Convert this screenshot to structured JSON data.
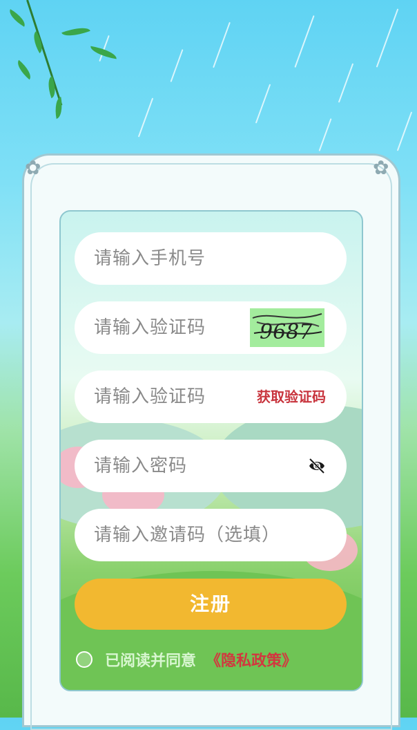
{
  "form": {
    "phone_placeholder": "请输入手机号",
    "captcha_placeholder": "请输入验证码",
    "captcha_text": "9687",
    "sms_placeholder": "请输入验证码",
    "sms_button": "获取验证码",
    "password_placeholder": "请输入密码",
    "invite_placeholder": "请输入邀请码（选填）",
    "register_button": "注册",
    "agree_text": "已阅读并同意",
    "policy_link": "《隐私政策》"
  },
  "colors": {
    "register": "#f2b830",
    "link": "#c8343d"
  },
  "icons": {
    "password_toggle": "eye-off-icon"
  }
}
